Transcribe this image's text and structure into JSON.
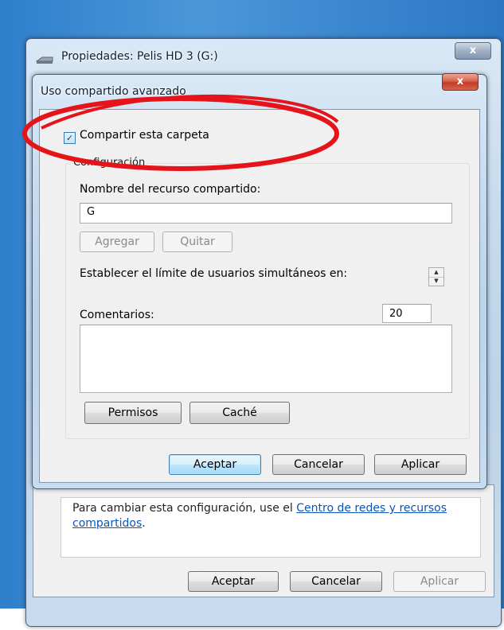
{
  "back_window": {
    "title": "Propiedades: Pelis HD 3 (G:)",
    "close_label": "x",
    "info_text": "Para cambiar esta configuración, use el ",
    "info_link": "Centro de redes y recursos compartidos",
    "info_end": ".",
    "buttons": {
      "ok": "Aceptar",
      "cancel": "Cancelar",
      "apply": "Aplicar"
    }
  },
  "dialog": {
    "title": "Uso compartido avanzado",
    "close_label": "x",
    "share_checkbox": {
      "label": "Compartir esta carpeta",
      "checked": true
    },
    "group_title": "Configuración",
    "share_name_label": "Nombre del recurso compartido:",
    "share_name_value": "G",
    "add_label": "Agregar",
    "remove_label": "Quitar",
    "user_limit_label": "Establecer el límite de usuarios simultáneos en:",
    "user_limit_value": "20",
    "comments_label": "Comentarios:",
    "comments_value": "",
    "permissions_label": "Permisos",
    "cache_label": "Caché",
    "buttons": {
      "ok": "Aceptar",
      "cancel": "Cancelar",
      "apply": "Aplicar"
    }
  },
  "colors": {
    "highlight_ellipse": "#e4141a",
    "link": "#0b55b8",
    "desktop": "#3b86cf"
  }
}
